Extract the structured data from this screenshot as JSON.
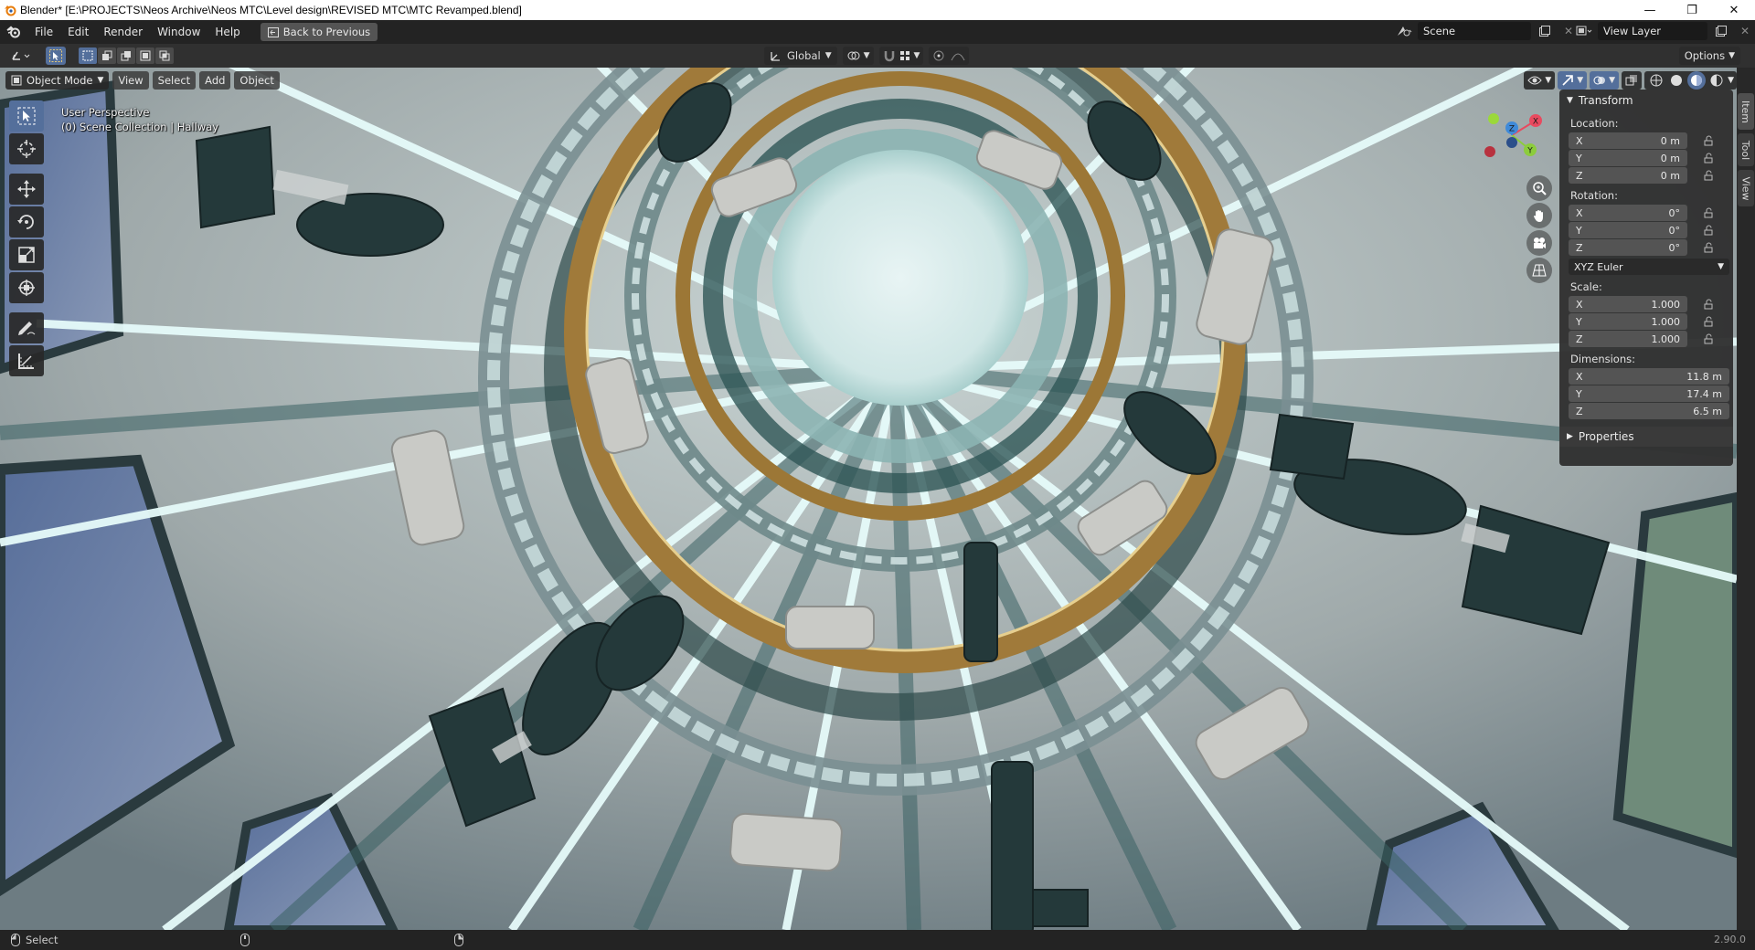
{
  "window": {
    "title": "Blender* [E:\\PROJECTS\\Neos Archive\\Neos MTC\\Level design\\REVISED MTC\\MTC Revamped.blend]"
  },
  "topbar": {
    "menus": [
      "File",
      "Edit",
      "Render",
      "Window",
      "Help"
    ],
    "back_button": "Back to Previous",
    "scene": "Scene",
    "view_layer": "View Layer"
  },
  "editor_header": {
    "orientation": "Global",
    "options": "Options"
  },
  "viewport": {
    "mode": "Object Mode",
    "menus": [
      "View",
      "Select",
      "Add",
      "Object"
    ],
    "perspective_label": "User Perspective",
    "collection_label": "(0) Scene Collection | Hallway",
    "gizmo_axes": [
      "X",
      "Y",
      "Z"
    ]
  },
  "npanel": {
    "transform_title": "Transform",
    "location_label": "Location:",
    "location": [
      {
        "axis": "X",
        "value": "0 m"
      },
      {
        "axis": "Y",
        "value": "0 m"
      },
      {
        "axis": "Z",
        "value": "0 m"
      }
    ],
    "rotation_label": "Rotation:",
    "rotation": [
      {
        "axis": "X",
        "value": "0°"
      },
      {
        "axis": "Y",
        "value": "0°"
      },
      {
        "axis": "Z",
        "value": "0°"
      }
    ],
    "rotation_mode": "XYZ Euler",
    "scale_label": "Scale:",
    "scale": [
      {
        "axis": "X",
        "value": "1.000"
      },
      {
        "axis": "Y",
        "value": "1.000"
      },
      {
        "axis": "Z",
        "value": "1.000"
      }
    ],
    "dimensions_label": "Dimensions:",
    "dimensions": [
      {
        "axis": "X",
        "value": "11.8 m"
      },
      {
        "axis": "Y",
        "value": "17.4 m"
      },
      {
        "axis": "Z",
        "value": "6.5 m"
      }
    ],
    "properties_title": "Properties"
  },
  "sidetabs": [
    "Item",
    "Tool",
    "View"
  ],
  "statusbar": {
    "select": "Select",
    "version": "2.90.0"
  },
  "colors": {
    "accent": "#546f9b",
    "panel": "#303030",
    "axis_x": "#e84a5f",
    "axis_y": "#8ccc3c",
    "axis_z": "#3f8ad9"
  }
}
